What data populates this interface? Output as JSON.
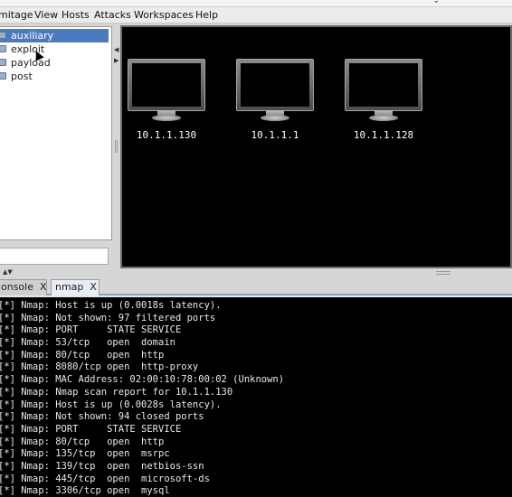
{
  "menubar": {
    "items": [
      "mitage",
      "View",
      "Hosts",
      "Attacks",
      "Workspaces",
      "Help"
    ]
  },
  "module_tree": {
    "items": [
      {
        "label": "auxiliary",
        "selected": true
      },
      {
        "label": "exploit",
        "selected": false
      },
      {
        "label": "payload",
        "selected": false
      },
      {
        "label": "post",
        "selected": false
      }
    ],
    "search_value": ""
  },
  "targets": {
    "background": "#000000",
    "hosts": [
      {
        "ip": "10.1.1.130",
        "icon": "monitor-icon"
      },
      {
        "ip": "10.1.1.1",
        "icon": "monitor-icon"
      },
      {
        "ip": "10.1.1.128",
        "icon": "monitor-icon"
      }
    ]
  },
  "tabs": [
    {
      "label": "onsole",
      "close": "X",
      "active": false
    },
    {
      "label": "nmap",
      "close": "X",
      "active": true
    }
  ],
  "console": {
    "lines": [
      "[*] Nmap: Host is up (0.0018s latency).",
      "[*] Nmap: Not shown: 97 filtered ports",
      "[*] Nmap: PORT     STATE SERVICE",
      "[*] Nmap: 53/tcp   open  domain",
      "[*] Nmap: 80/tcp   open  http",
      "[*] Nmap: 8080/tcp open  http-proxy",
      "[*] Nmap: MAC Address: 02:00:10:78:00:02 (Unknown)",
      "[*] Nmap: Nmap scan report for 10.1.1.130",
      "[*] Nmap: Host is up (0.0028s latency).",
      "[*] Nmap: Not shown: 94 closed ports",
      "[*] Nmap: PORT     STATE SERVICE",
      "[*] Nmap: 80/tcp   open  http",
      "[*] Nmap: 135/tcp  open  msrpc",
      "[*] Nmap: 139/tcp  open  netbios-ssn",
      "[*] Nmap: 445/tcp  open  microsoft-ds",
      "[*] Nmap: 3306/tcp open  mysql"
    ]
  },
  "colors": {
    "selection": "#4a7bbf",
    "console_bg": "#000000",
    "console_fg": "#e8e8e8"
  }
}
